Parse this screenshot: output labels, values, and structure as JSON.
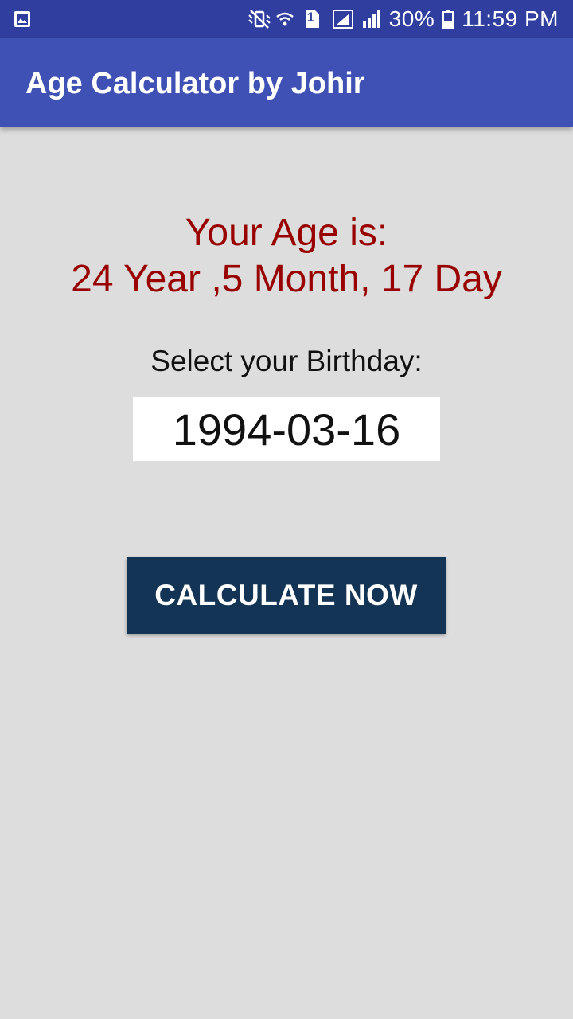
{
  "status_bar": {
    "battery_percent": "30%",
    "time": "11:59 PM",
    "sim_number": "1",
    "icons": [
      "image-icon",
      "mute-vibrate-icon",
      "wifi-icon",
      "sim-icon",
      "signal-icon",
      "signal-icon",
      "battery-icon"
    ]
  },
  "app_bar": {
    "title": "Age Calculator by Johir"
  },
  "result": {
    "heading": "Your Age is:",
    "value": "24 Year ,5 Month, 17 Day"
  },
  "birthday": {
    "label": "Select your Birthday:",
    "date": "1994-03-16"
  },
  "actions": {
    "calculate_label": "CALCULATE NOW"
  },
  "colors": {
    "status_bar": "#303f9f",
    "app_bar": "#3f51b5",
    "background": "#dddddd",
    "result_text": "#990000",
    "button": "#133455"
  }
}
